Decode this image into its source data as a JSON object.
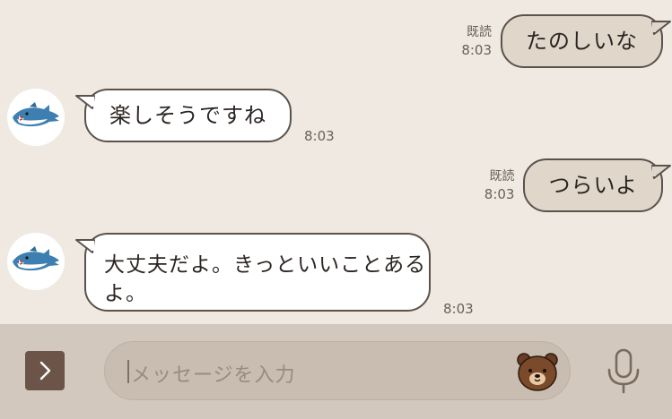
{
  "chat": {
    "messages": [
      {
        "direction": "outgoing",
        "text": "たのしいな",
        "read_label": "既読",
        "time": "8:03"
      },
      {
        "direction": "incoming",
        "text": "楽しそうですね",
        "time": "8:03"
      },
      {
        "direction": "outgoing",
        "text": "つらいよ",
        "read_label": "既読",
        "time": "8:03"
      },
      {
        "direction": "incoming",
        "line1": "大丈夫だよ。きっといいことある",
        "line2": "よ。",
        "time": "8:03"
      }
    ]
  },
  "input_bar": {
    "placeholder": "メッセージを入力",
    "icons": {
      "expand": "chevron-right-icon",
      "sticker": "bear-sticker-icon",
      "voice": "microphone-icon"
    }
  },
  "colors": {
    "background": "#efe9e2",
    "outgoing_bubble": "#e0d6ca",
    "incoming_bubble": "#ffffff",
    "input_bar": "#d3c8bd",
    "accent_button": "#6c5449",
    "timestamp": "#6b5f56"
  }
}
